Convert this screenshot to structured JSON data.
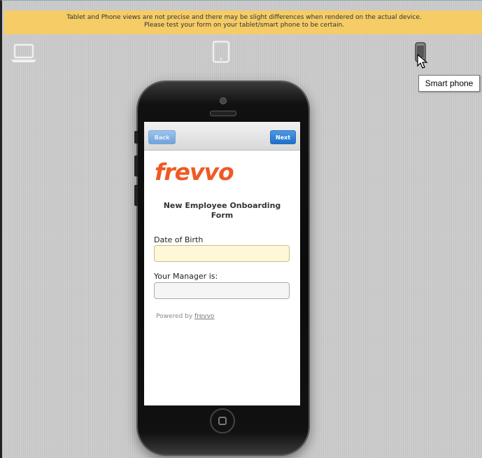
{
  "banner": {
    "line1": "Tablet and Phone views are not precise and there may be slight differences when rendered on the actual device.",
    "line2": "Please test your form on your tablet/smart phone to be certain."
  },
  "views": {
    "laptop_icon": "laptop-icon",
    "tablet_icon": "tablet-icon",
    "phone_icon": "smartphone-icon",
    "selected": "smartphone",
    "tooltip": "Smart phone"
  },
  "form": {
    "back_label": "Back",
    "next_label": "Next",
    "logo_text": "frevvo",
    "title": "New Employee Onboarding Form",
    "dob_label": "Date of Birth",
    "dob_value": "",
    "manager_label": "Your Manager is:",
    "manager_value": "",
    "powered_prefix": "Powered by",
    "powered_link": "frevvo"
  },
  "colors": {
    "banner": "#f5cc66",
    "accent": "#1e6fc8",
    "logo": "#ef5a24",
    "dob_field_bg": "#fef7d8"
  }
}
